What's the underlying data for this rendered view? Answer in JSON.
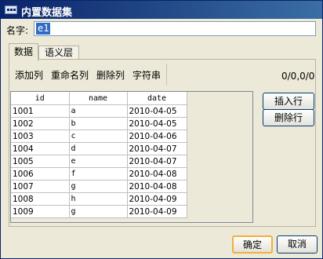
{
  "window": {
    "title": "内置数据集"
  },
  "name_field": {
    "label": "名字:",
    "value": "e1"
  },
  "tabs": [
    {
      "label": "数据"
    },
    {
      "label": "语义层"
    }
  ],
  "toolbar": {
    "add_column": "添加列",
    "rename_column": "重命名列",
    "delete_column": "删除列",
    "string": "字符串"
  },
  "counter": "0/0,0/0",
  "table": {
    "columns": [
      "id",
      "name",
      "date"
    ],
    "rows": [
      [
        "1001",
        "a",
        "2010-04-05"
      ],
      [
        "1002",
        "b",
        "2010-04-05"
      ],
      [
        "1003",
        "c",
        "2010-04-06"
      ],
      [
        "1004",
        "d",
        "2010-04-07"
      ],
      [
        "1005",
        "e",
        "2010-04-07"
      ],
      [
        "1006",
        "f",
        "2010-04-08"
      ],
      [
        "1007",
        "g",
        "2010-04-08"
      ],
      [
        "1008",
        "h",
        "2010-04-09"
      ],
      [
        "1009",
        "g",
        "2010-04-09"
      ]
    ]
  },
  "buttons": {
    "insert_row": "插入行",
    "delete_row": "删除行",
    "ok": "确定",
    "cancel": "取消"
  }
}
